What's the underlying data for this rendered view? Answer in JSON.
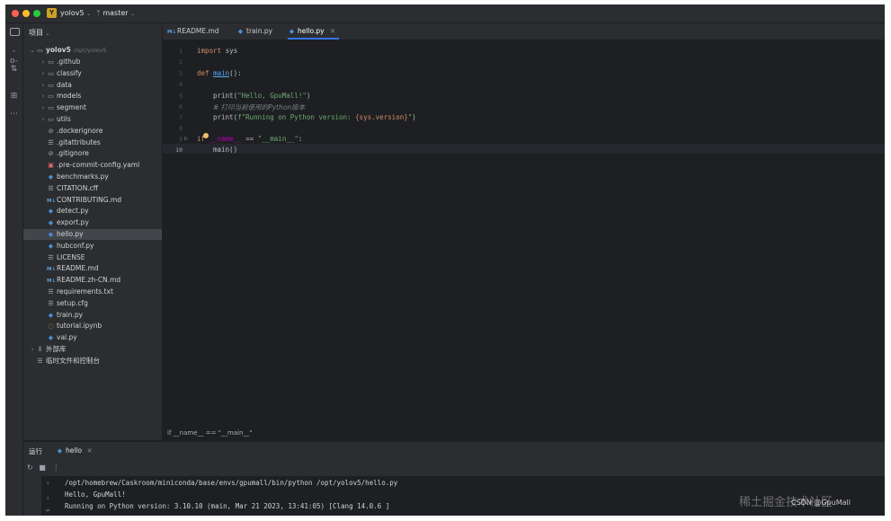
{
  "titlebar": {
    "project_badge": "Y",
    "project_name": "yolov5",
    "branch": "master"
  },
  "sidebar": {
    "header": "项目",
    "root_name": "yolov5",
    "root_path": "/opt/yolov5",
    "items": [
      {
        "label": ".github",
        "type": "folder"
      },
      {
        "label": "classify",
        "type": "folder"
      },
      {
        "label": "data",
        "type": "folder"
      },
      {
        "label": "models",
        "type": "folder"
      },
      {
        "label": "segment",
        "type": "folder"
      },
      {
        "label": "utils",
        "type": "folder"
      },
      {
        "label": ".dockerignore",
        "type": "ignore"
      },
      {
        "label": ".gitattributes",
        "type": "txt"
      },
      {
        "label": ".gitignore",
        "type": "ignore"
      },
      {
        "label": ".pre-commit-config.yaml",
        "type": "yaml"
      },
      {
        "label": "benchmarks.py",
        "type": "py"
      },
      {
        "label": "CITATION.cff",
        "type": "txt"
      },
      {
        "label": "CONTRIBUTING.md",
        "type": "md"
      },
      {
        "label": "detect.py",
        "type": "py"
      },
      {
        "label": "export.py",
        "type": "py"
      },
      {
        "label": "hello.py",
        "type": "py"
      },
      {
        "label": "hubconf.py",
        "type": "py"
      },
      {
        "label": "LICENSE",
        "type": "txt"
      },
      {
        "label": "README.md",
        "type": "md"
      },
      {
        "label": "README.zh-CN.md",
        "type": "md"
      },
      {
        "label": "requirements.txt",
        "type": "txt"
      },
      {
        "label": "setup.cfg",
        "type": "txt"
      },
      {
        "label": "train.py",
        "type": "py"
      },
      {
        "label": "tutorial.ipynb",
        "type": "ipynb"
      },
      {
        "label": "val.py",
        "type": "py"
      }
    ],
    "external_libs": "外部库",
    "scratches": "临时文件和控制台"
  },
  "tabs": [
    {
      "label": "README.md",
      "icon": "md"
    },
    {
      "label": "train.py",
      "icon": "py"
    },
    {
      "label": "hello.py",
      "icon": "py",
      "active": true
    }
  ],
  "editor": {
    "line_numbers": [
      "1",
      "2",
      "3",
      "4",
      "5",
      "6",
      "7",
      "8",
      "9",
      "10"
    ],
    "line1_kw": "import",
    "line1_rest": " sys",
    "line3_kw": "def",
    "line3_fn": "main",
    "line3_rest": "():",
    "line5_fn": "print",
    "line5_open": "(",
    "line5_str": "\"Hello, GpuMall!\"",
    "line5_close": ")",
    "line6_comment": "# 打印当前使用的Python版本",
    "line7_fn": "print",
    "line7_open": "(",
    "line7_str_a": "f\"Running on Python version: ",
    "line7_expr": "{sys.version}",
    "line7_str_b": "\"",
    "line7_close": ")",
    "line9_kw": "if",
    "line9_du": "__name__",
    "line9_op": " == ",
    "line9_str": "\"__main__\"",
    "line9_colon": ":",
    "line10_code": "main()",
    "breadcrumb": "if __name__ == \"__main__\""
  },
  "run": {
    "header": "运行",
    "tab_label": "hello",
    "console_lines": [
      "/opt/homebrew/Caskroom/miniconda/base/envs/gpumall/bin/python /opt/yolov5/hello.py",
      "Hello, GpuMall!",
      "Running on Python version: 3.10.10 (main, Mar 21 2023, 13:41:05) [Clang 14.0.6 ]"
    ]
  },
  "watermark": {
    "text": "稀土掘金技术社区",
    "overlay": "CSDN @GpuMall"
  },
  "colors": {
    "accent": "#3574f0",
    "keyword": "#cf8e6d",
    "function": "#56a8f5",
    "string": "#6aab73"
  }
}
